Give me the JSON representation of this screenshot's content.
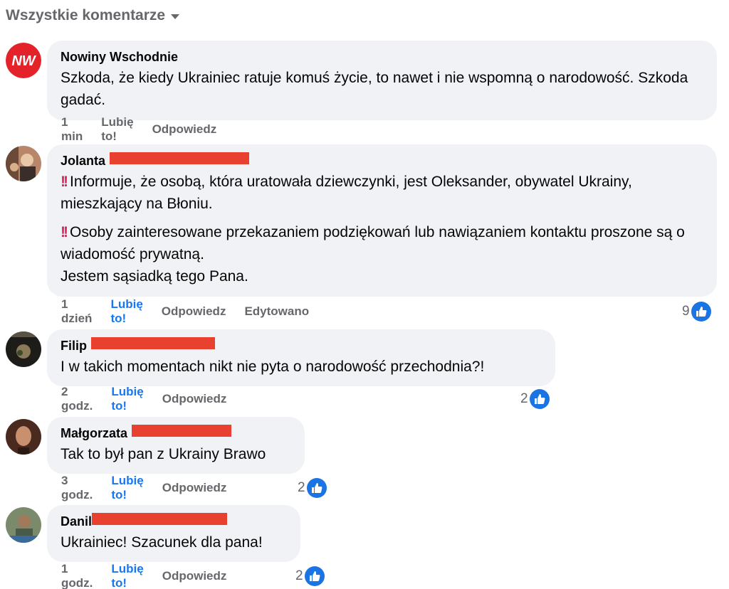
{
  "filter": {
    "label": "Wszystkie komentarze"
  },
  "comments": [
    {
      "author": "Nowiny Wschodnie",
      "avatar_text": "NW",
      "paragraphs": [
        "Szkoda, że kiedy Ukrainiec ratuje komuś życie, to nawet i nie wspomną o narodowość. Szkoda gadać."
      ],
      "time": "1 min",
      "like": "Lubię to!",
      "reply": "Odpowiedz",
      "liked": false
    },
    {
      "author": "Jolanta",
      "paragraphs": [
        "‼ Informuje, że osobą, która uratowała dziewczynki, jest Oleksander, obywatel Ukrainy, mieszkający na Błoniu.",
        "‼ Osoby zainteresowane przekazaniem podziękowań lub nawiązaniem kontaktu proszone są o wiadomość prywatną.",
        "Jestem sąsiadką tego Pana."
      ],
      "time": "1 dzień",
      "like": "Lubię to!",
      "reply": "Odpowiedz",
      "edited": "Edytowano",
      "liked": true,
      "reaction_count": "9"
    },
    {
      "author": "Filip",
      "paragraphs": [
        "I w takich momentach nikt nie pyta o narodowość przechodnia?!"
      ],
      "time": "2 godz.",
      "like": "Lubię to!",
      "reply": "Odpowiedz",
      "liked": true,
      "reaction_count": "2"
    },
    {
      "author": "Małgorzata",
      "paragraphs": [
        "Tak to był pan z Ukrainy Brawo"
      ],
      "time": "3 godz.",
      "like": "Lubię to!",
      "reply": "Odpowiedz",
      "liked": true,
      "reaction_count": "2"
    },
    {
      "author": "Danil",
      "paragraphs": [
        "Ukrainiec! Szacunek dla pana!"
      ],
      "time": "1 godz.",
      "like": "Lubię to!",
      "reply": "Odpowiedz",
      "liked": true,
      "reaction_count": "2"
    }
  ],
  "icons": {
    "like": "thumbs-up-icon",
    "caret": "caret-down-icon"
  },
  "colors": {
    "accent": "#1877f2",
    "redaction": "#e8412f",
    "bubble": "#f0f2f5",
    "brand": "#e4222a"
  }
}
